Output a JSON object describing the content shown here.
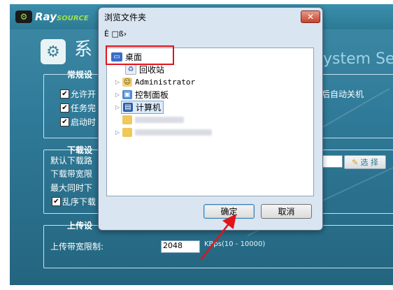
{
  "app": {
    "logo_badge": "⚙",
    "logo_name": "Ray",
    "logo_sub": "SOURCE",
    "title": "系",
    "title_right": "ystem Set",
    "groups": {
      "general": {
        "title": "常规设"
      },
      "download": {
        "title": "下载设"
      },
      "upload": {
        "title": "上传设"
      }
    },
    "general_items": [
      {
        "label": "允许开",
        "checked": "✔"
      },
      {
        "label": "任务完",
        "checked": "✔"
      },
      {
        "label": "启动时",
        "checked": "✔"
      }
    ],
    "auto_shutdown": "后自动关机",
    "download_labels": [
      "默认下载路",
      "下载带宽限",
      "最大同时下",
      "乱序下载"
    ],
    "shuffle_checked": "✔",
    "select_button": "选 择",
    "upload_label": "上传带宽限制:",
    "upload_value": "2048",
    "upload_unit": "KBps(10 - 10000)"
  },
  "dialog": {
    "title": "浏览文件夹",
    "close": "✕",
    "toolbar_text": "È □ß›",
    "tree": [
      {
        "label": "桌面",
        "selected": false
      },
      {
        "label": "回收站"
      },
      {
        "label": "Administrator"
      },
      {
        "label": "控制面板"
      },
      {
        "label": "计算机",
        "selected": true
      }
    ],
    "ok": "确定",
    "cancel": "取消"
  }
}
